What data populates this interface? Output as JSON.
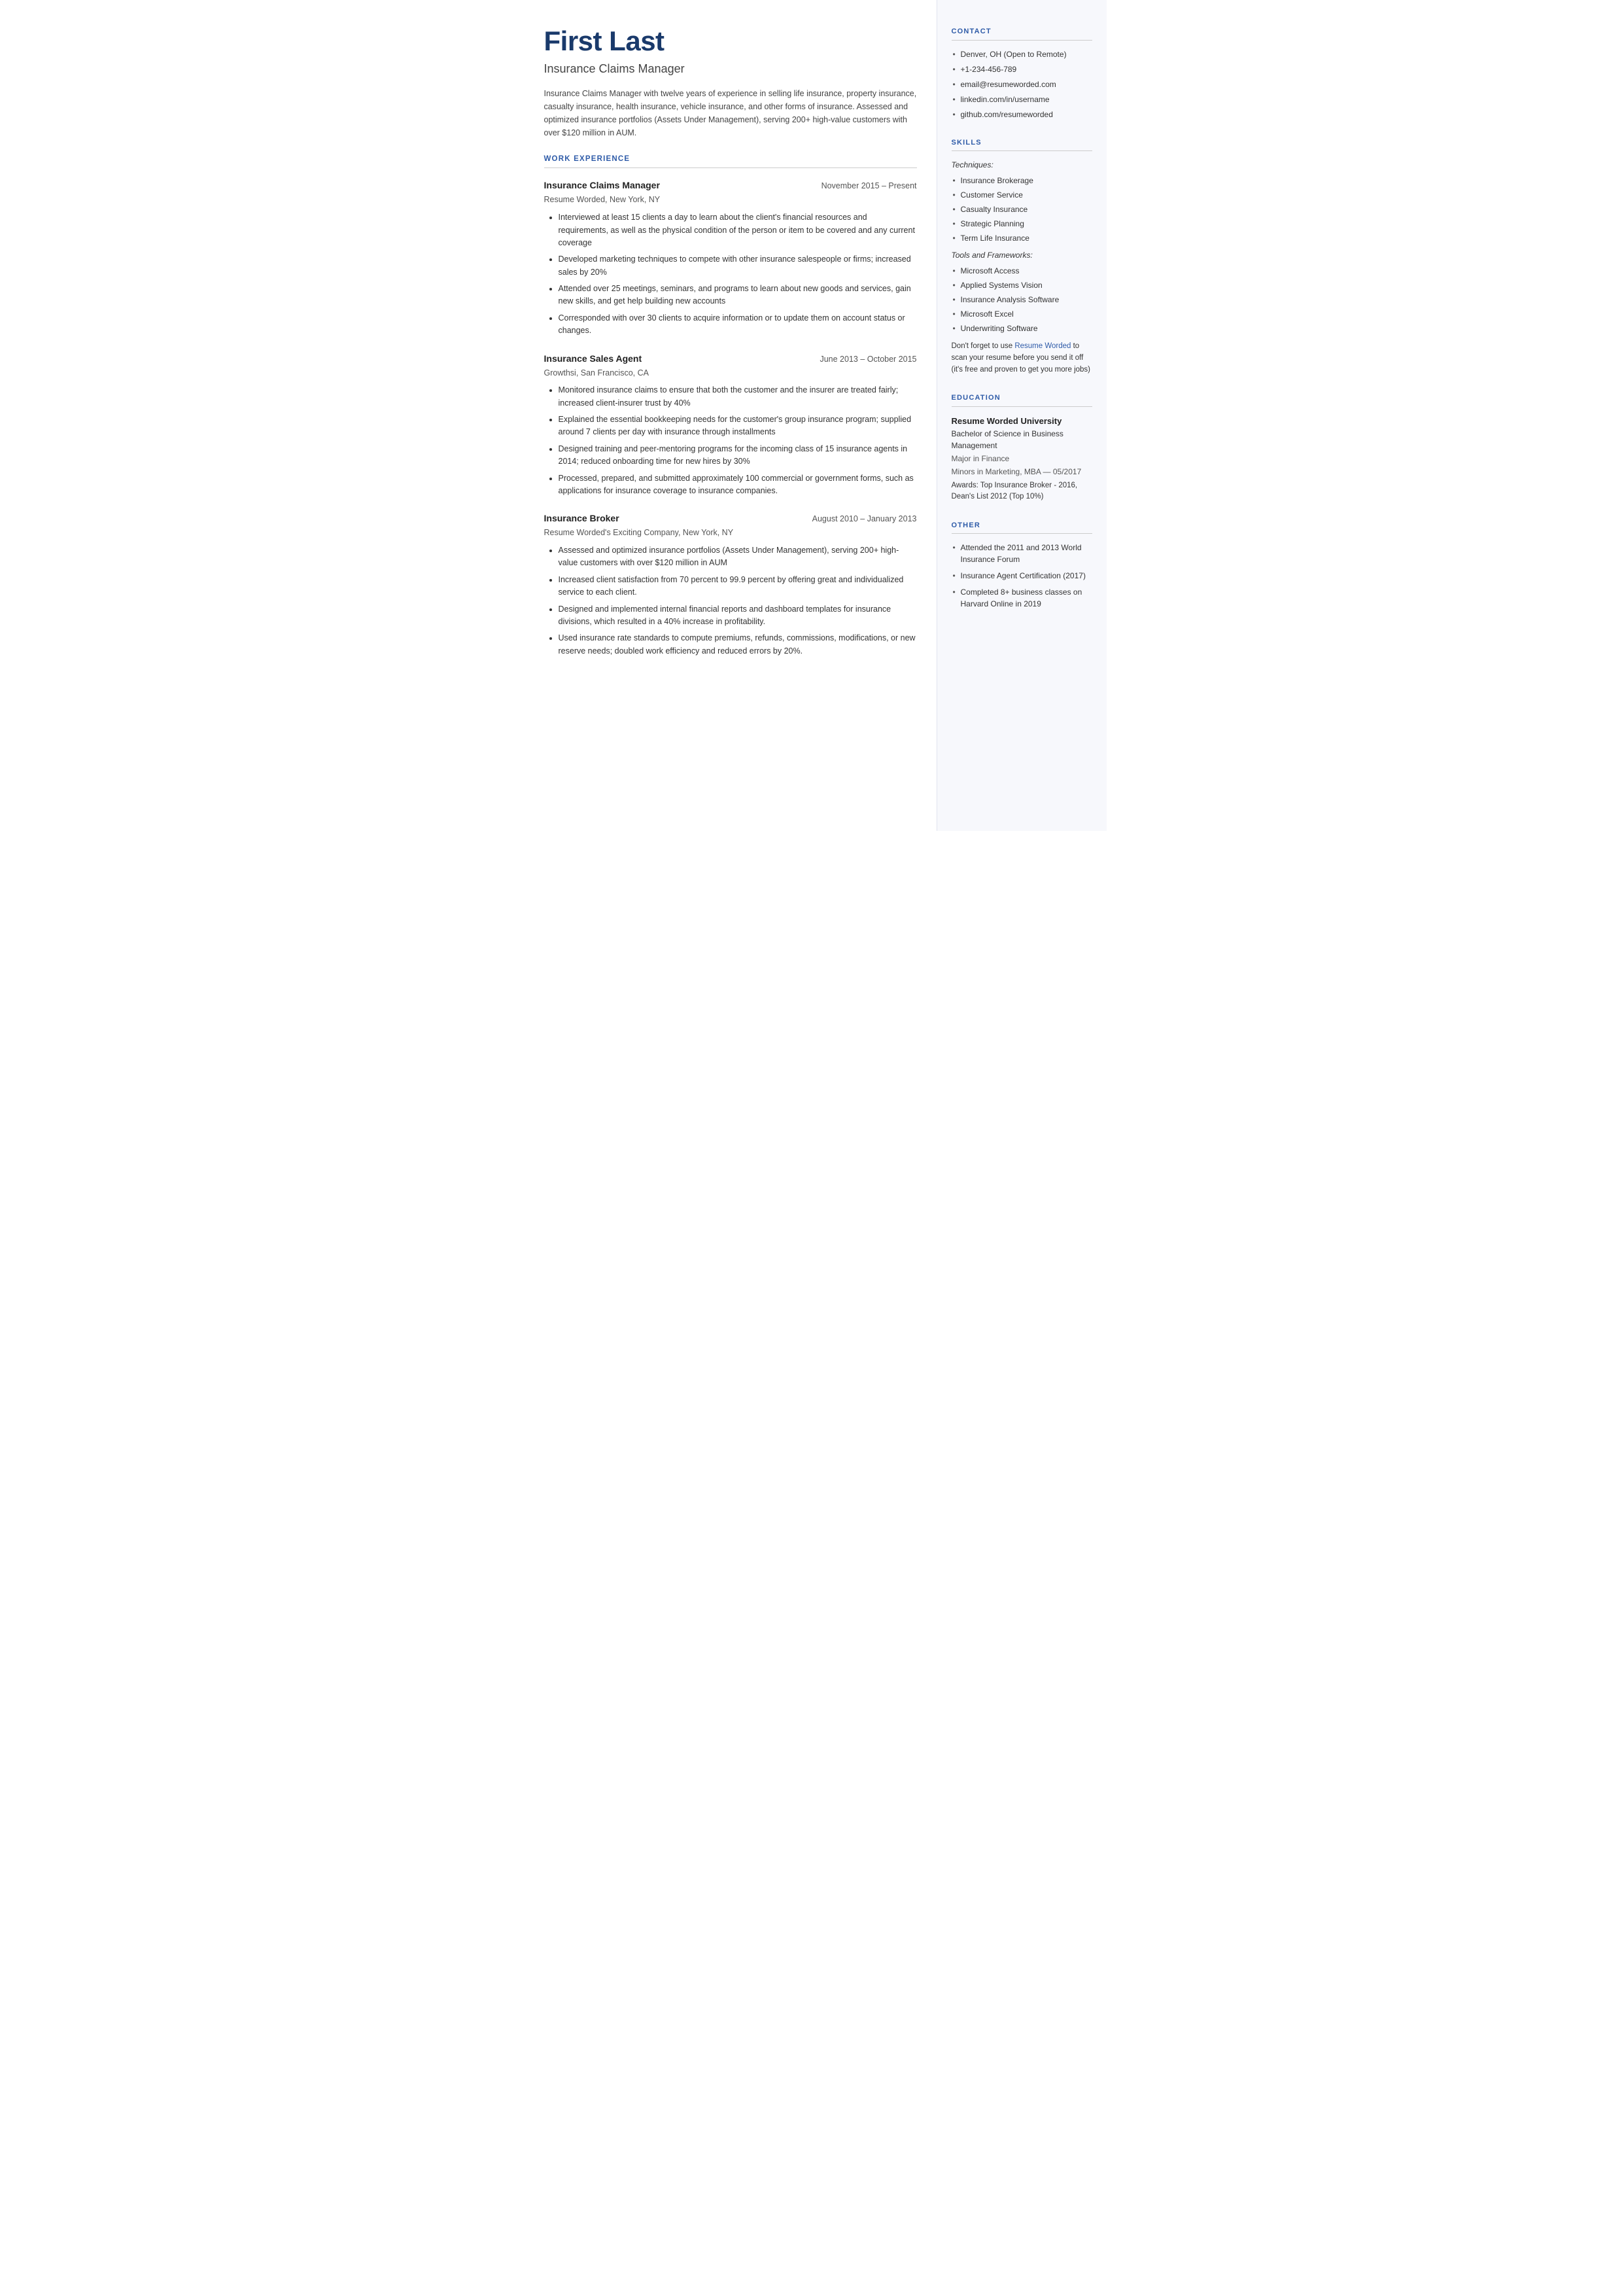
{
  "header": {
    "name": "First Last",
    "job_title": "Insurance Claims Manager",
    "summary": "Insurance Claims Manager with twelve years of experience in selling life insurance, property insurance, casualty insurance, health insurance, vehicle insurance, and other forms of insurance. Assessed and optimized insurance portfolios (Assets Under Management), serving 200+ high-value customers with over $120 million in AUM."
  },
  "sections": {
    "work_experience_label": "WORK EXPERIENCE",
    "jobs": [
      {
        "role": "Insurance Claims Manager",
        "dates": "November 2015 – Present",
        "company": "Resume Worded, New York, NY",
        "bullets": [
          "Interviewed at least 15 clients a day to learn about the client's financial resources and requirements, as well as the physical condition of the person or item to be covered and any current coverage",
          "Developed marketing techniques to compete with other insurance salespeople or firms; increased sales by 20%",
          "Attended over 25 meetings, seminars, and programs to learn about new goods and services, gain new skills, and get help building new accounts",
          "Corresponded with over 30 clients to acquire information or to update them on account status or changes."
        ]
      },
      {
        "role": "Insurance Sales Agent",
        "dates": "June 2013 – October 2015",
        "company": "Growthsi, San Francisco, CA",
        "bullets": [
          "Monitored insurance claims to ensure that both the customer and the insurer are treated fairly; increased client-insurer trust by 40%",
          "Explained the essential bookkeeping needs for the customer's group insurance program; supplied around 7 clients per day with insurance through installments",
          "Designed training and peer-mentoring programs for the incoming class of 15 insurance agents in 2014; reduced onboarding time for new hires by 30%",
          "Processed, prepared, and submitted approximately 100 commercial or government forms, such as applications for insurance coverage to insurance companies."
        ]
      },
      {
        "role": "Insurance Broker",
        "dates": "August 2010 – January 2013",
        "company": "Resume Worded's Exciting Company, New York, NY",
        "bullets": [
          "Assessed and optimized insurance portfolios (Assets Under Management), serving 200+ high-value customers with over $120 million in AUM",
          "Increased client satisfaction from 70 percent to 99.9 percent by offering great and individualized service to each client.",
          "Designed and implemented internal financial reports and dashboard templates for insurance divisions, which resulted in a 40% increase in profitability.",
          "Used insurance rate standards to compute premiums, refunds, commissions, modifications, or new reserve needs; doubled work efficiency and reduced errors by 20%."
        ]
      }
    ]
  },
  "sidebar": {
    "contact_label": "CONTACT",
    "contact": [
      "Denver, OH (Open to Remote)",
      "+1-234-456-789",
      "email@resumeworded.com",
      "linkedin.com/in/username",
      "github.com/resumeworded"
    ],
    "skills_label": "SKILLS",
    "skills_techniques_label": "Techniques:",
    "skills_techniques": [
      "Insurance Brokerage",
      "Customer Service",
      "Casualty Insurance",
      "Strategic Planning",
      "Term Life Insurance"
    ],
    "skills_tools_label": "Tools and Frameworks:",
    "skills_tools": [
      "Microsoft Access",
      "Applied Systems Vision",
      "Insurance Analysis Software",
      "Microsoft Excel",
      "Underwriting Software"
    ],
    "promo_text": "Don't forget to use ",
    "promo_link_text": "Resume Worded",
    "promo_text2": " to scan your resume before you send it off (it's free and proven to get you more jobs)",
    "education_label": "EDUCATION",
    "education": {
      "university": "Resume Worded University",
      "degree": "Bachelor of Science in Business Management",
      "major": "Major in Finance",
      "minors": "Minors in Marketing, MBA — 05/2017",
      "awards": "Awards: Top Insurance Broker - 2016, Dean's List 2012 (Top 10%)"
    },
    "other_label": "OTHER",
    "other": [
      "Attended the 2011 and 2013 World Insurance Forum",
      "Insurance Agent Certification (2017)",
      "Completed 8+ business classes on Harvard Online in 2019"
    ]
  }
}
